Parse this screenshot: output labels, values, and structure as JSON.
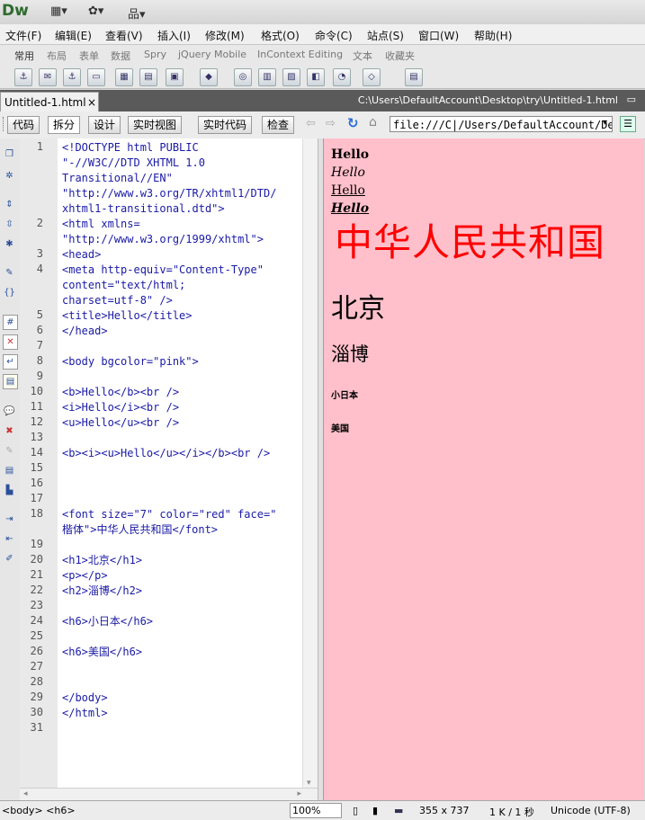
{
  "app": {
    "logo": "Dw",
    "icons": [
      "layout-icon",
      "gear-icon",
      "sitemap-icon"
    ]
  },
  "menu": [
    "文件(F)",
    "编辑(E)",
    "查看(V)",
    "插入(I)",
    "修改(M)",
    "格式(O)",
    "命令(C)",
    "站点(S)",
    "窗口(W)",
    "帮助(H)"
  ],
  "insert_tabs": [
    "常用",
    "布局",
    "表单",
    "数据",
    "Spry",
    "jQuery Mobile",
    "InContext Editing",
    "文本",
    "收藏夹"
  ],
  "document": {
    "tab_label": "Untitled-1.html",
    "close": "×",
    "path": "C:\\Users\\DefaultAccount\\Desktop\\try\\Untitled-1.html"
  },
  "view_buttons": [
    "代码",
    "拆分",
    "设计",
    "实时视图"
  ],
  "live_code": "实时代码",
  "inspect": "检查",
  "address": "file:///C|/Users/DefaultAccount/Deskto",
  "code_lines": [
    {
      "n": "1",
      "text": "<!DOCTYPE html PUBLIC"
    },
    {
      "n": "",
      "text": "\"-//W3C//DTD XHTML 1.0"
    },
    {
      "n": "",
      "text": "Transitional//EN\""
    },
    {
      "n": "",
      "text": "\"http://www.w3.org/TR/xhtml1/DTD/"
    },
    {
      "n": "",
      "text": "xhtml1-transitional.dtd\">"
    },
    {
      "n": "2",
      "text": "<html xmlns="
    },
    {
      "n": "",
      "text": "\"http://www.w3.org/1999/xhtml\">"
    },
    {
      "n": "3",
      "text": "<head>"
    },
    {
      "n": "4",
      "text": "<meta http-equiv=\"Content-Type\""
    },
    {
      "n": "",
      "text": "content=\"text/html;"
    },
    {
      "n": "",
      "text": "charset=utf-8\" />"
    },
    {
      "n": "5",
      "text": "<title>Hello</title>"
    },
    {
      "n": "6",
      "text": "</head>"
    },
    {
      "n": "7",
      "text": ""
    },
    {
      "n": "8",
      "text": "<body bgcolor=\"pink\">"
    },
    {
      "n": "9",
      "text": ""
    },
    {
      "n": "10",
      "text": "<b>Hello</b><br />"
    },
    {
      "n": "11",
      "text": "<i>Hello</i><br />"
    },
    {
      "n": "12",
      "text": "<u>Hello</u><br />"
    },
    {
      "n": "13",
      "text": ""
    },
    {
      "n": "14",
      "text": "<b><i><u>Hello</u></i></b><br />"
    },
    {
      "n": "15",
      "text": ""
    },
    {
      "n": "16",
      "text": ""
    },
    {
      "n": "17",
      "text": ""
    },
    {
      "n": "18",
      "text": "<font size=\"7\" color=\"red\" face=\""
    },
    {
      "n": "",
      "text": "楷体\">中华人民共和国</font>"
    },
    {
      "n": "19",
      "text": ""
    },
    {
      "n": "20",
      "text": "<h1>北京</h1>"
    },
    {
      "n": "21",
      "text": "<p></p>"
    },
    {
      "n": "22",
      "text": "<h2>淄博</h2>"
    },
    {
      "n": "23",
      "text": ""
    },
    {
      "n": "24",
      "text": "<h6>小日本</h6>"
    },
    {
      "n": "25",
      "text": ""
    },
    {
      "n": "26",
      "text": "<h6>美国</h6>"
    },
    {
      "n": "27",
      "text": ""
    },
    {
      "n": "28",
      "text": ""
    },
    {
      "n": "29",
      "text": "</body>"
    },
    {
      "n": "30",
      "text": "</html>"
    },
    {
      "n": "31",
      "text": ""
    }
  ],
  "preview": {
    "bold": "Hello",
    "italic": "Hello",
    "underline": "Hello",
    "biu": "Hello",
    "font_text": "中华人民共和国",
    "font_color": "#ff0000",
    "h1": "北京",
    "h2": "淄博",
    "h6a": "小日本",
    "h6b": "美国",
    "bgcolor": "#ffc0cb"
  },
  "status": {
    "tags": "<body> <h6>",
    "zoom": "100%",
    "size": "355 x 737",
    "filesize": "1 K / 1 秒",
    "encoding": "Unicode (UTF-8)"
  }
}
